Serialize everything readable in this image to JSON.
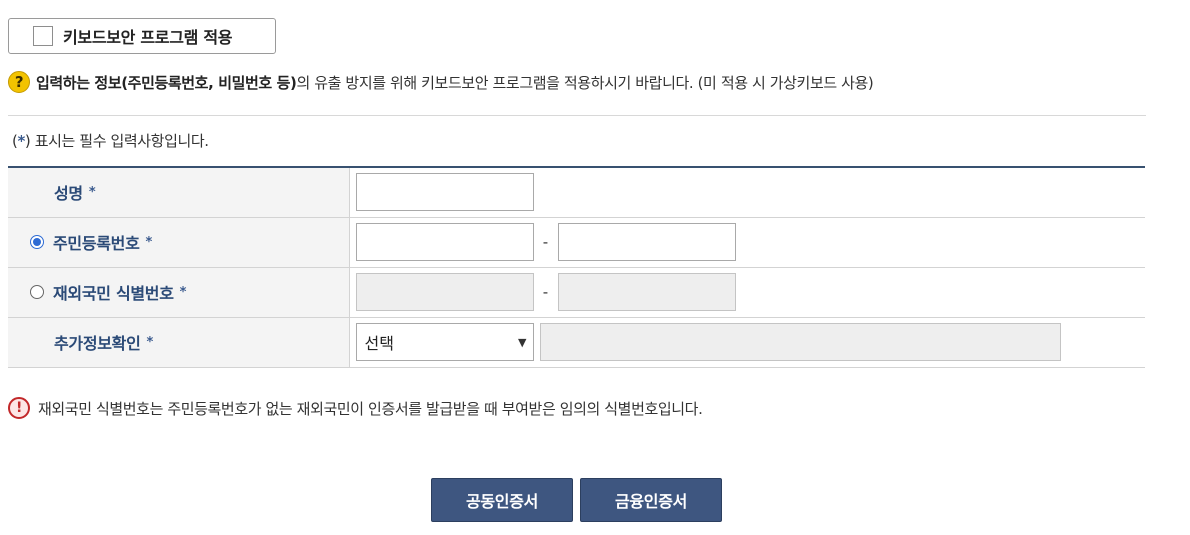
{
  "keyboard_security": {
    "label": "키보드보안 프로그램 적용",
    "checked": false
  },
  "notice": {
    "bold": "입력하는 정보(주민등록번호, 비밀번호 등)",
    "rest": "의 유출 방지를 위해 키보드보안 프로그램을 적용하시기 바랍니다. (미 적용 시 가상키보드 사용)"
  },
  "required_note": {
    "open": "(",
    "star": "*",
    "rest": ") 표시는 필수 입력사항입니다."
  },
  "form": {
    "required_mark": "*",
    "name_label": "성명",
    "resident_label": "주민등록번호",
    "foreign_label": "재외국민 식별번호",
    "extra_label": "추가정보확인",
    "dash": "-",
    "extra_select_value": "선택",
    "resident_selected": true
  },
  "warning": "재외국민 식별번호는 주민등록번호가 없는 재외국민이 인증서를 발급받을 때 부여받은 임의의 식별번호입니다.",
  "buttons": {
    "joint_cert": "공동인증서",
    "financial_cert": "금융인증서"
  },
  "colors": {
    "primary_button": "#3e5680",
    "label": "#2b4a77",
    "table_top_border": "#385170"
  }
}
